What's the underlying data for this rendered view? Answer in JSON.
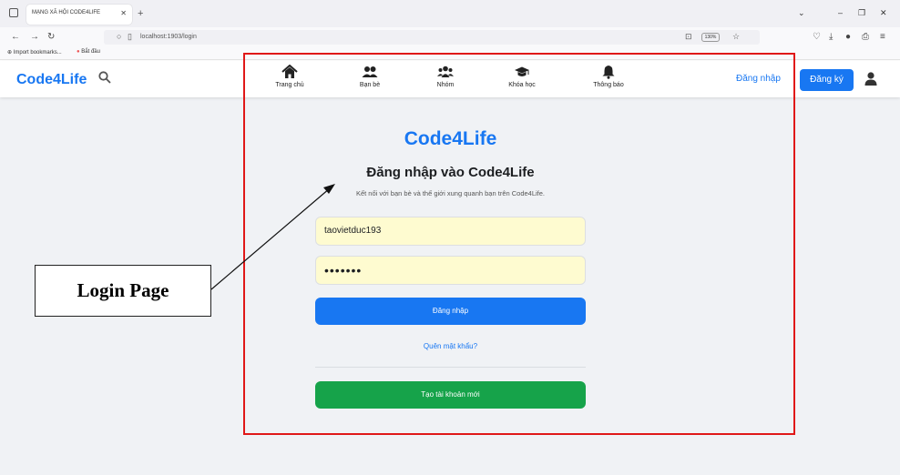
{
  "browser": {
    "tab_title": "MẠNG XÃ HỘI CODE4LIFE",
    "url": "localhost:1903/login",
    "zoom": "130%",
    "bookmarks": [
      "Import bookmarks...",
      "Bắt đầu"
    ]
  },
  "site": {
    "brand": "Code4Life",
    "menu": [
      {
        "label": "Trang chủ",
        "icon": "home-icon"
      },
      {
        "label": "Bạn bè",
        "icon": "friends-icon"
      },
      {
        "label": "Nhóm",
        "icon": "group-icon"
      },
      {
        "label": "Khóa học",
        "icon": "graduation-cap-icon"
      },
      {
        "label": "Thông báo",
        "icon": "bell-icon"
      }
    ],
    "login_link": "Đăng nhập",
    "signup_button": "Đăng ký"
  },
  "login": {
    "title": "Code4Life",
    "heading": "Đăng nhập vào Code4Life",
    "subtitle": "Kết nối với bạn bè và thế giới xung quanh bạn trên Code4Life.",
    "username_value": "taovietduc193",
    "password_value": "•••••••",
    "login_button": "Đăng nhập",
    "forgot_link": "Quên mật khẩu?",
    "create_button": "Tạo tài khoản mới"
  },
  "annotation": {
    "label": "Login Page",
    "frame_color": "#e01818"
  },
  "colors": {
    "brand": "#1877f2",
    "create_green": "#16a34a",
    "field_bg": "#fefbd0"
  }
}
